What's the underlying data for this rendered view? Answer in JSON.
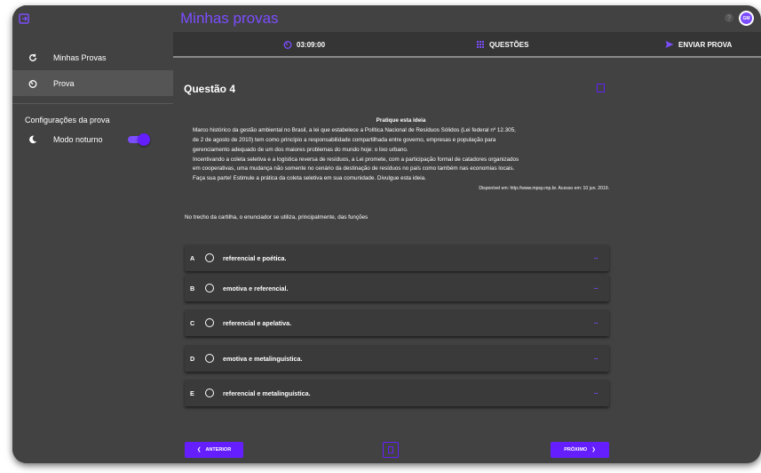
{
  "header": {
    "title": "Minhas provas",
    "avatar_initials": "GM"
  },
  "sidebar": {
    "items": [
      {
        "label": "Minhas Provas",
        "icon": "refresh-icon",
        "active": false
      },
      {
        "label": "Prova",
        "icon": "timer-icon",
        "active": true
      }
    ],
    "settings_title": "Configurações da prova",
    "night_mode_label": "Modo noturno",
    "night_mode_on": true
  },
  "toolbar": {
    "timer": "03:09:00",
    "questions_label": "QUESTÕES",
    "submit_label": "ENVIAR PROVA"
  },
  "question": {
    "title": "Questão 4",
    "text_heading": "Pratique esta ideia",
    "text_lines": [
      "Marco histórico da gestão ambiental no Brasil, a lei que estabelece a Política Nacional de Resíduos Sólidos (Lei federal nº 12.305,",
      "de 2 de agosto de 2010) tem como princípio a responsabilidade compartilhada entre governo, empresas e população para",
      "gerenciamento adequado de um dos maiores problemas do mundo hoje: o lixo urbano.",
      "Incentivando a coleta seletiva e a logística reversa de resíduos, a Lei promete, com a participação formal de catadores organizados",
      "em cooperativas, uma mudança não somente no cenário da destinação de resíduos no país como também nas economias locais.",
      "Faça sua parte! Estimule a prática da coleta seletiva em sua comunidade. Divulgue esta ideia."
    ],
    "source": "Disponível em: http://www.mpsp.mp.br. Acesso em: 10 jun. 2019.",
    "prompt": "No trecho da cartilha, o enunciador se utiliza, principalmente, das funções",
    "options": [
      {
        "letter": "A",
        "text": "referencial e poética."
      },
      {
        "letter": "B",
        "text": "emotiva e referencial."
      },
      {
        "letter": "C",
        "text": "referencial e apelativa."
      },
      {
        "letter": "D",
        "text": "emotiva e metalinguística."
      },
      {
        "letter": "E",
        "text": "referencial e metalinguística."
      }
    ],
    "options_more": "...",
    "prev_label": "ANTERIOR",
    "next_label": "PRÓXIMO"
  },
  "colors": {
    "accent": "#7c4dff",
    "accent_dark": "#651fff",
    "background": "#424242",
    "toolbar": "#353535",
    "card": "#3a3a3a"
  }
}
